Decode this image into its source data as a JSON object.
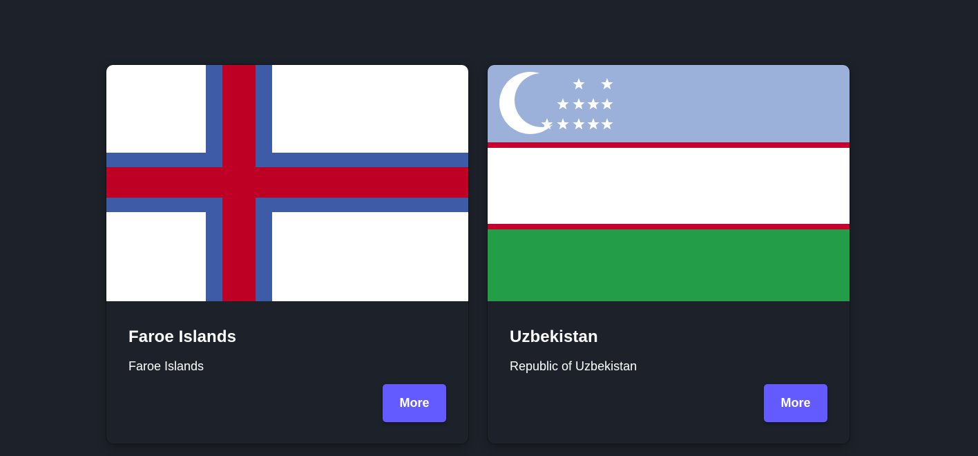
{
  "countries": [
    {
      "name": "Faroe Islands",
      "official_name": "Faroe Islands",
      "button_label": "More",
      "flag_icon": "faroe-islands-flag",
      "flag_colors": {
        "field": "#ffffff",
        "cross_outer": "#3e5ba8",
        "cross_inner": "#bd0024"
      }
    },
    {
      "name": "Uzbekistan",
      "official_name": "Republic of Uzbekistan",
      "button_label": "More",
      "flag_icon": "uzbekistan-flag",
      "flag_colors": {
        "top": "#9cb1da",
        "stripe": "#c4022e",
        "middle": "#ffffff",
        "bottom": "#239d47"
      }
    }
  ],
  "colors": {
    "background": "#1d222a",
    "button": "#635bff",
    "text": "#ffffff"
  }
}
